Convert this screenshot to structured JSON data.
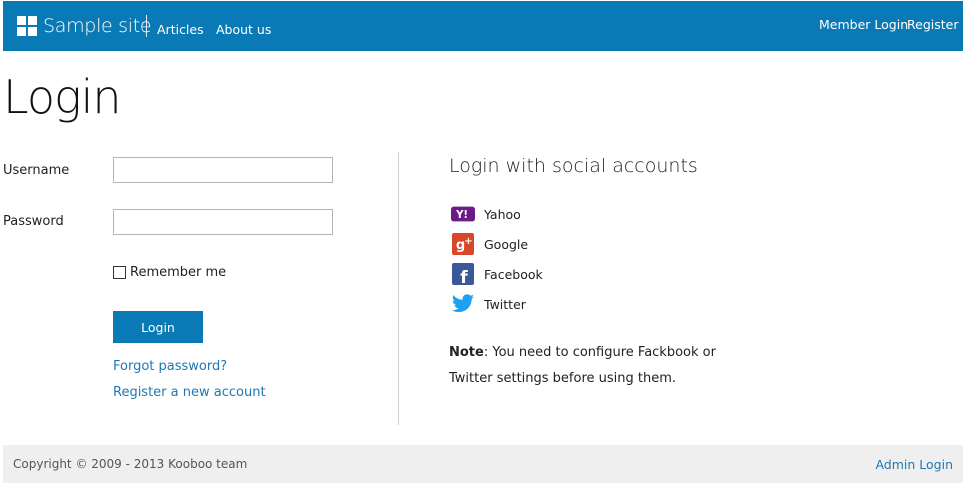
{
  "header": {
    "brand": "Sample site",
    "nav": [
      "Articles",
      "About us"
    ],
    "member_login": "Member Login",
    "register": "Register",
    "bar_color": "#0a7ab6"
  },
  "page": {
    "title": "Login"
  },
  "form": {
    "username_label": "Username",
    "username_value": "",
    "password_label": "Password",
    "password_value": "",
    "remember_label": "Remember me",
    "remember_checked": false,
    "login_button": "Login",
    "forgot_link": "Forgot password?",
    "register_link": "Register a new account"
  },
  "social": {
    "title": "Login with social accounts",
    "providers": [
      {
        "label": "Yahoo",
        "icon": "yahoo-icon"
      },
      {
        "label": "Google",
        "icon": "google-plus-icon"
      },
      {
        "label": "Facebook",
        "icon": "facebook-icon"
      },
      {
        "label": "Twitter",
        "icon": "twitter-icon"
      }
    ],
    "note_label": "Note",
    "note_text": ": You need to configure Fackbook or Twitter settings before using them."
  },
  "footer": {
    "copyright": "Copyright © 2009 - 2013 Kooboo team",
    "admin_login": "Admin Login"
  }
}
